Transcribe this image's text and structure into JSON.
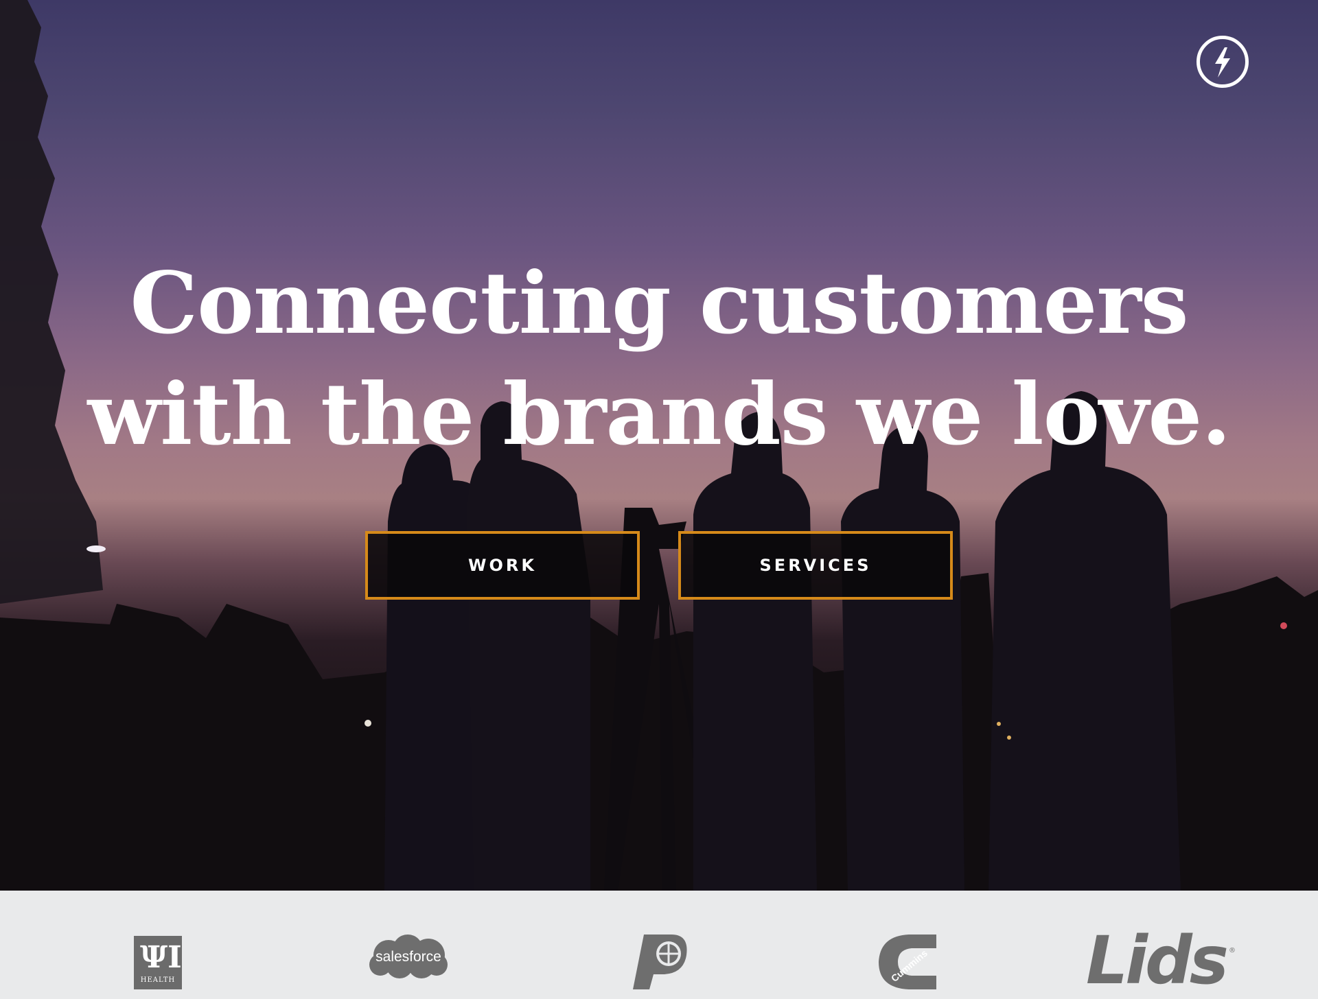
{
  "hero": {
    "headline_line1": "Connecting customers",
    "headline_line2": "with the brands we love.",
    "buttons": {
      "work": "WORK",
      "services": "SERVICES"
    },
    "logo_icon": "lightning-bolt-icon"
  },
  "clients": {
    "iu_health": {
      "mark": "ΨΙ",
      "word": "HEALTH"
    },
    "salesforce": "salesforce",
    "pacers": "pacers-logo",
    "cummins": "Cummins",
    "lids": "Lids",
    "lids_reg": "®"
  },
  "colors": {
    "button_border": "#d68a1a",
    "logo_gray": "#6e6e6e",
    "strip_bg": "#e9eaeb"
  }
}
